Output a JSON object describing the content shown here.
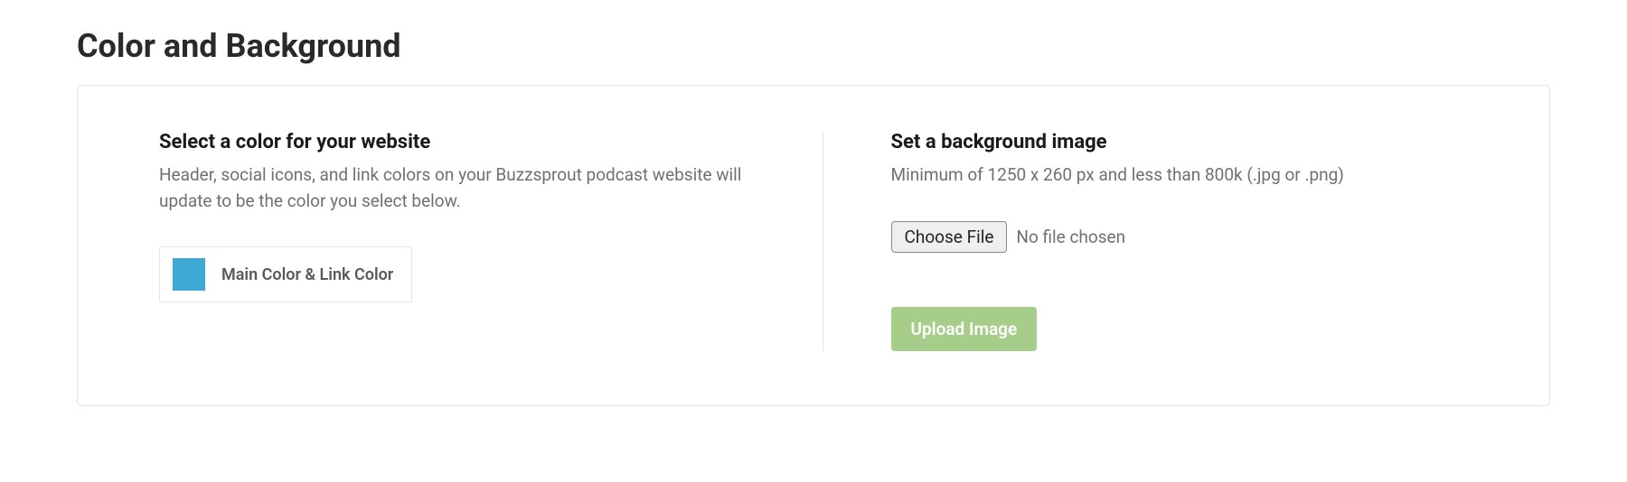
{
  "page": {
    "title": "Color and Background"
  },
  "color_section": {
    "heading": "Select a color for your website",
    "description": "Header, social icons, and link colors on your Buzzsprout podcast website will update to be the color you select below.",
    "swatch_color": "#3fa9d6",
    "picker_label": "Main Color & Link Color"
  },
  "background_section": {
    "heading": "Set a background image",
    "description": "Minimum of 1250 x 260 px and less than 800k (.jpg or .png)",
    "choose_file_label": "Choose File",
    "file_status": "No file chosen",
    "upload_label": "Upload Image"
  }
}
